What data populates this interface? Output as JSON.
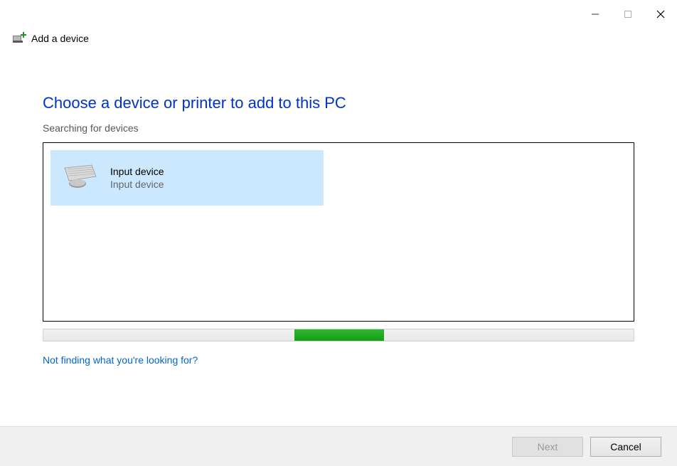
{
  "window": {
    "title": "Add a device"
  },
  "content": {
    "heading": "Choose a device or printer to add to this PC",
    "status": "Searching for devices",
    "help_link": "Not finding what you're looking for?"
  },
  "devices": [
    {
      "name": "Input device",
      "type": "Input device",
      "icon": "keyboard-mouse"
    }
  ],
  "footer": {
    "next_label": "Next",
    "cancel_label": "Cancel"
  }
}
